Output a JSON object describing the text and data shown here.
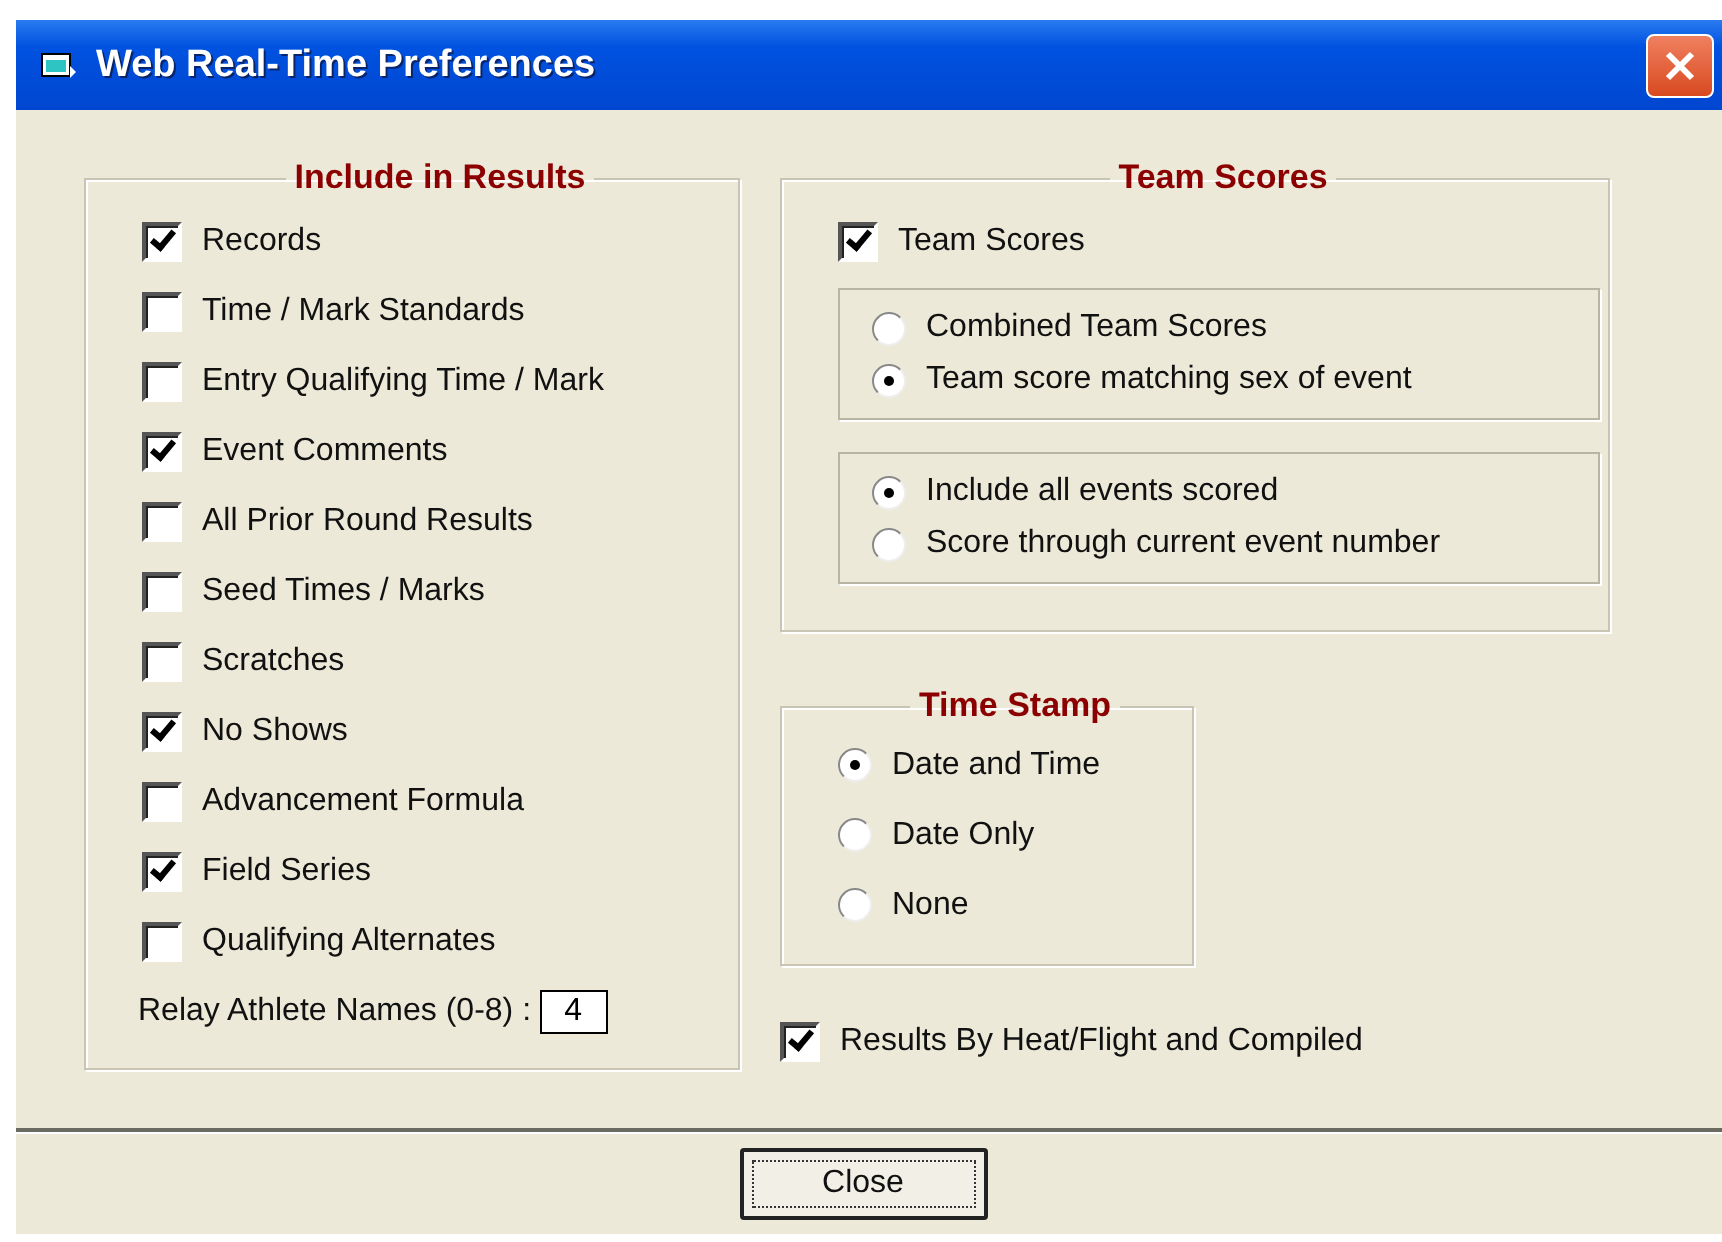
{
  "window": {
    "title": "Web Real-Time Preferences"
  },
  "include_in_results": {
    "title": "Include in Results",
    "options": [
      {
        "label": "Records",
        "checked": true
      },
      {
        "label": "Time / Mark Standards",
        "checked": false
      },
      {
        "label": "Entry Qualifying Time / Mark",
        "checked": false
      },
      {
        "label": "Event Comments",
        "checked": true
      },
      {
        "label": "All Prior Round Results",
        "checked": false
      },
      {
        "label": "Seed Times / Marks",
        "checked": false
      },
      {
        "label": "Scratches",
        "checked": false
      },
      {
        "label": "No Shows",
        "checked": true
      },
      {
        "label": "Advancement Formula",
        "checked": false
      },
      {
        "label": "Field Series",
        "checked": true
      },
      {
        "label": "Qualifying Alternates",
        "checked": false
      }
    ],
    "relay_athlete_names": {
      "label": "Relay Athlete Names (0-8) :",
      "value": "4"
    }
  },
  "team_scores": {
    "title": "Team Scores",
    "checkbox": {
      "label": "Team Scores",
      "checked": true
    },
    "groups": [
      [
        {
          "label": "Combined Team Scores",
          "selected": false
        },
        {
          "label": "Team score matching sex of event",
          "selected": true
        }
      ],
      [
        {
          "label": "Include all events scored",
          "selected": true
        },
        {
          "label": "Score through current event number",
          "selected": false
        }
      ]
    ]
  },
  "time_stamp": {
    "title": "Time Stamp",
    "options": [
      {
        "label": "Date and Time",
        "selected": true
      },
      {
        "label": "Date Only",
        "selected": false
      },
      {
        "label": "None",
        "selected": false
      }
    ]
  },
  "results_by_heat": {
    "label": "Results By Heat/Flight and Compiled",
    "checked": true
  },
  "buttons": [
    {
      "label": "Close"
    }
  ]
}
